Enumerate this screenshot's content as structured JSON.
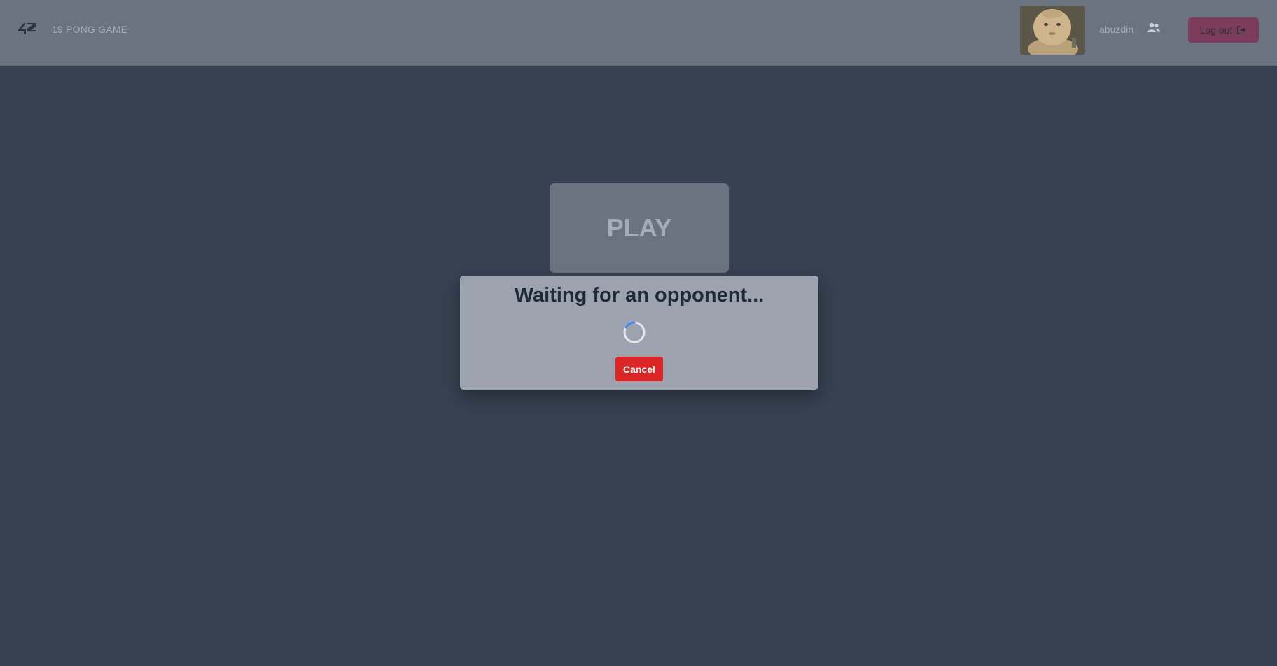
{
  "header": {
    "logo_text": "42",
    "app_title": "19 PONG GAME",
    "username": "abuzdin",
    "logout_label": "Log out"
  },
  "icons": {
    "logo": "42-logo-icon",
    "friends": "users-icon",
    "logout": "sign-out-icon",
    "spinner": "loading-spinner-icon"
  },
  "main": {
    "play_label": "PLAY"
  },
  "modal": {
    "title": "Waiting for an opponent...",
    "cancel_label": "Cancel"
  },
  "colors": {
    "background": "#374151",
    "header": "#6b7280",
    "modal": "#9ca3af",
    "cancel": "#dc2626",
    "logout": "#7c3c5c"
  }
}
